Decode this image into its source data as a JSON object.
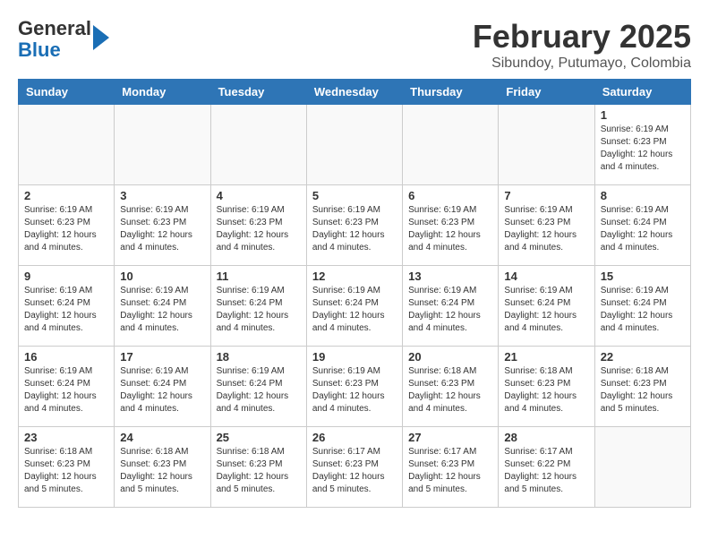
{
  "header": {
    "logo_line1": "General",
    "logo_line2": "Blue",
    "main_title": "February 2025",
    "subtitle": "Sibundoy, Putumayo, Colombia"
  },
  "calendar": {
    "days_of_week": [
      "Sunday",
      "Monday",
      "Tuesday",
      "Wednesday",
      "Thursday",
      "Friday",
      "Saturday"
    ],
    "weeks": [
      [
        {
          "day": "",
          "info": ""
        },
        {
          "day": "",
          "info": ""
        },
        {
          "day": "",
          "info": ""
        },
        {
          "day": "",
          "info": ""
        },
        {
          "day": "",
          "info": ""
        },
        {
          "day": "",
          "info": ""
        },
        {
          "day": "1",
          "info": "Sunrise: 6:19 AM\nSunset: 6:23 PM\nDaylight: 12 hours\nand 4 minutes."
        }
      ],
      [
        {
          "day": "2",
          "info": "Sunrise: 6:19 AM\nSunset: 6:23 PM\nDaylight: 12 hours\nand 4 minutes."
        },
        {
          "day": "3",
          "info": "Sunrise: 6:19 AM\nSunset: 6:23 PM\nDaylight: 12 hours\nand 4 minutes."
        },
        {
          "day": "4",
          "info": "Sunrise: 6:19 AM\nSunset: 6:23 PM\nDaylight: 12 hours\nand 4 minutes."
        },
        {
          "day": "5",
          "info": "Sunrise: 6:19 AM\nSunset: 6:23 PM\nDaylight: 12 hours\nand 4 minutes."
        },
        {
          "day": "6",
          "info": "Sunrise: 6:19 AM\nSunset: 6:23 PM\nDaylight: 12 hours\nand 4 minutes."
        },
        {
          "day": "7",
          "info": "Sunrise: 6:19 AM\nSunset: 6:23 PM\nDaylight: 12 hours\nand 4 minutes."
        },
        {
          "day": "8",
          "info": "Sunrise: 6:19 AM\nSunset: 6:24 PM\nDaylight: 12 hours\nand 4 minutes."
        }
      ],
      [
        {
          "day": "9",
          "info": "Sunrise: 6:19 AM\nSunset: 6:24 PM\nDaylight: 12 hours\nand 4 minutes."
        },
        {
          "day": "10",
          "info": "Sunrise: 6:19 AM\nSunset: 6:24 PM\nDaylight: 12 hours\nand 4 minutes."
        },
        {
          "day": "11",
          "info": "Sunrise: 6:19 AM\nSunset: 6:24 PM\nDaylight: 12 hours\nand 4 minutes."
        },
        {
          "day": "12",
          "info": "Sunrise: 6:19 AM\nSunset: 6:24 PM\nDaylight: 12 hours\nand 4 minutes."
        },
        {
          "day": "13",
          "info": "Sunrise: 6:19 AM\nSunset: 6:24 PM\nDaylight: 12 hours\nand 4 minutes."
        },
        {
          "day": "14",
          "info": "Sunrise: 6:19 AM\nSunset: 6:24 PM\nDaylight: 12 hours\nand 4 minutes."
        },
        {
          "day": "15",
          "info": "Sunrise: 6:19 AM\nSunset: 6:24 PM\nDaylight: 12 hours\nand 4 minutes."
        }
      ],
      [
        {
          "day": "16",
          "info": "Sunrise: 6:19 AM\nSunset: 6:24 PM\nDaylight: 12 hours\nand 4 minutes."
        },
        {
          "day": "17",
          "info": "Sunrise: 6:19 AM\nSunset: 6:24 PM\nDaylight: 12 hours\nand 4 minutes."
        },
        {
          "day": "18",
          "info": "Sunrise: 6:19 AM\nSunset: 6:24 PM\nDaylight: 12 hours\nand 4 minutes."
        },
        {
          "day": "19",
          "info": "Sunrise: 6:19 AM\nSunset: 6:23 PM\nDaylight: 12 hours\nand 4 minutes."
        },
        {
          "day": "20",
          "info": "Sunrise: 6:18 AM\nSunset: 6:23 PM\nDaylight: 12 hours\nand 4 minutes."
        },
        {
          "day": "21",
          "info": "Sunrise: 6:18 AM\nSunset: 6:23 PM\nDaylight: 12 hours\nand 4 minutes."
        },
        {
          "day": "22",
          "info": "Sunrise: 6:18 AM\nSunset: 6:23 PM\nDaylight: 12 hours\nand 5 minutes."
        }
      ],
      [
        {
          "day": "23",
          "info": "Sunrise: 6:18 AM\nSunset: 6:23 PM\nDaylight: 12 hours\nand 5 minutes."
        },
        {
          "day": "24",
          "info": "Sunrise: 6:18 AM\nSunset: 6:23 PM\nDaylight: 12 hours\nand 5 minutes."
        },
        {
          "day": "25",
          "info": "Sunrise: 6:18 AM\nSunset: 6:23 PM\nDaylight: 12 hours\nand 5 minutes."
        },
        {
          "day": "26",
          "info": "Sunrise: 6:17 AM\nSunset: 6:23 PM\nDaylight: 12 hours\nand 5 minutes."
        },
        {
          "day": "27",
          "info": "Sunrise: 6:17 AM\nSunset: 6:23 PM\nDaylight: 12 hours\nand 5 minutes."
        },
        {
          "day": "28",
          "info": "Sunrise: 6:17 AM\nSunset: 6:22 PM\nDaylight: 12 hours\nand 5 minutes."
        },
        {
          "day": "",
          "info": ""
        }
      ]
    ]
  }
}
